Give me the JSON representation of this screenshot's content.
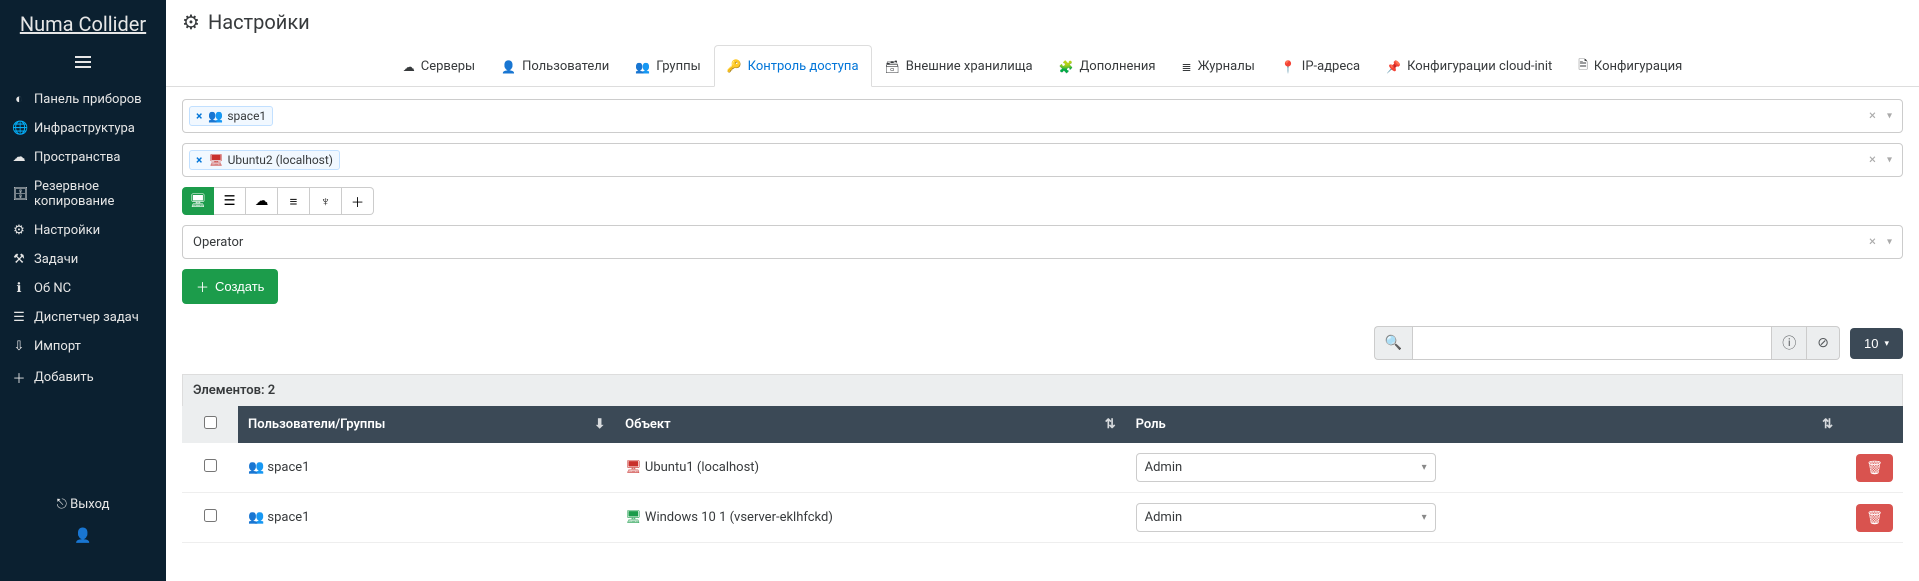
{
  "brand": "Numa Collider",
  "header": {
    "title": "Настройки"
  },
  "sidebar": {
    "items": [
      {
        "label": "Панель приборов",
        "icon": "dashboard"
      },
      {
        "label": "Инфраструктура",
        "icon": "globe"
      },
      {
        "label": "Пространства",
        "icon": "cloud"
      },
      {
        "label": "Резервное копирование",
        "icon": "backup"
      },
      {
        "label": "Настройки",
        "icon": "gear"
      },
      {
        "label": "Задачи",
        "icon": "tasks"
      },
      {
        "label": "Об NC",
        "icon": "info"
      },
      {
        "label": "Диспетчер задач",
        "icon": "list"
      },
      {
        "label": "Импорт",
        "icon": "import"
      },
      {
        "label": "Добавить",
        "icon": "plus"
      }
    ],
    "exit": "Выход"
  },
  "tabs": {
    "items": [
      {
        "label": "Серверы",
        "icon": "cloud"
      },
      {
        "label": "Пользователи",
        "icon": "user"
      },
      {
        "label": "Группы",
        "icon": "users"
      },
      {
        "label": "Контроль доступа",
        "icon": "key",
        "active": true
      },
      {
        "label": "Внешние хранилища",
        "icon": "storage"
      },
      {
        "label": "Дополнения",
        "icon": "plugin"
      },
      {
        "label": "Журналы",
        "icon": "log"
      },
      {
        "label": "IP-адреса",
        "icon": "marker"
      },
      {
        "label": "Конфигурации cloud-init",
        "icon": "pin"
      },
      {
        "label": "Конфигурация",
        "icon": "file"
      }
    ]
  },
  "selectors": {
    "subject_tag": "space1",
    "object_tag": "Ubuntu2 (localhost)",
    "role": "Operator"
  },
  "filters": {
    "buttons": [
      "desktop",
      "server",
      "cloud",
      "stack",
      "tree",
      "plus"
    ],
    "active_index": 0
  },
  "buttons": {
    "create": "Создать"
  },
  "search": {
    "value": "",
    "page_size": "10"
  },
  "table": {
    "count_label": "Элементов: 2",
    "headers": {
      "users_groups": "Пользователи/Группы",
      "object": "Объект",
      "role": "Роль"
    },
    "rows": [
      {
        "subject": "space1",
        "object": "Ubuntu1 (localhost)",
        "object_color": "red",
        "role": "Admin"
      },
      {
        "subject": "space1",
        "object": "Windows 10 1 (vserver-eklhfckd)",
        "object_color": "green",
        "role": "Admin"
      }
    ]
  }
}
